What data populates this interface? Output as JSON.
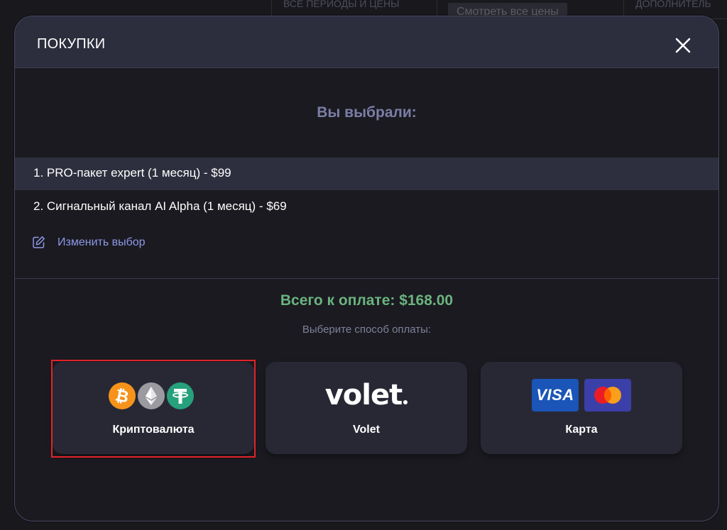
{
  "background": {
    "tabs": [
      "ВСЕ ПЕРИОДЫ И ЦЕНЫ",
      "ДОПОЛНИТЕЛЬ"
    ],
    "button": "Смотреть все цены"
  },
  "modal": {
    "title": "ПОКУПКИ",
    "chosen_heading": "Вы выбрали:",
    "items": [
      "1.  PRO-пакет expert (1 месяц) - $99",
      "2.  Сигнальный канал AI Alpha (1 месяц) - $69"
    ],
    "change_label": "Изменить выбор",
    "total": "Всего к оплате: $168.00",
    "choose_method": "Выберите способ оплаты:",
    "methods": [
      {
        "label": "Криптовалюта",
        "selected": true
      },
      {
        "label": "Volet",
        "logo_text": "volet"
      },
      {
        "label": "Карта",
        "logo_text": "VISA"
      }
    ]
  },
  "colors": {
    "accent_link": "#8d98e6",
    "total_green": "#6bb37f",
    "heading": "#7b7ea6",
    "selection": "#e2232a"
  }
}
